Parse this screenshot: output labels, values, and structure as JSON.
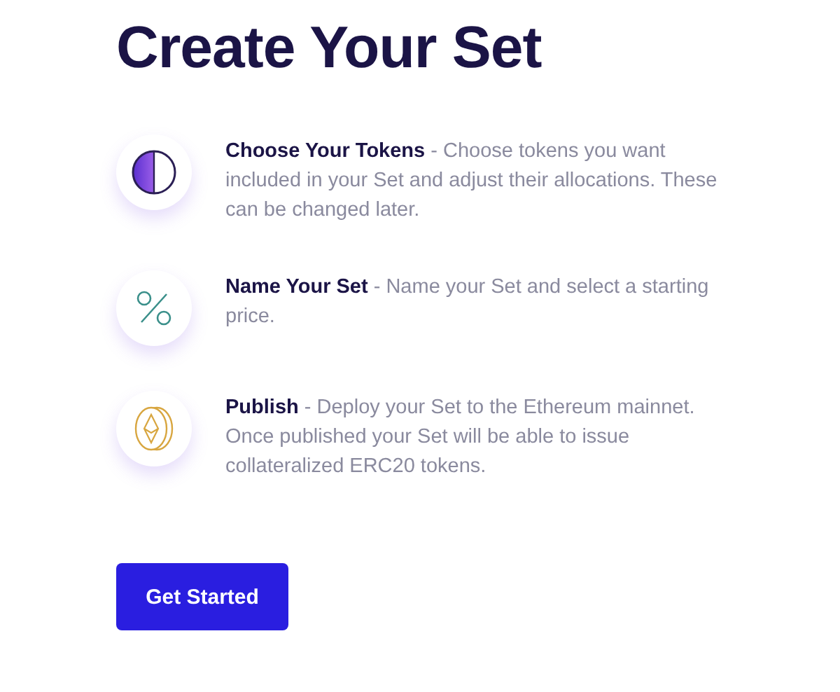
{
  "title": "Create Your Set",
  "steps": [
    {
      "kind": "half-circle",
      "text": "**Choose Your Tokens** - Choose tokens you want included in your Set and adjust their allocations. These can be changed later."
    },
    {
      "kind": "percent",
      "text": "**Name Your Set** - Name your Set and select a starting price."
    },
    {
      "kind": "coin",
      "text": "**Publish** - Deploy your Set to the Ethereum mainnet. Once published your Set will be able to issue collateralized ERC20 tokens."
    }
  ],
  "button": "Get Started"
}
